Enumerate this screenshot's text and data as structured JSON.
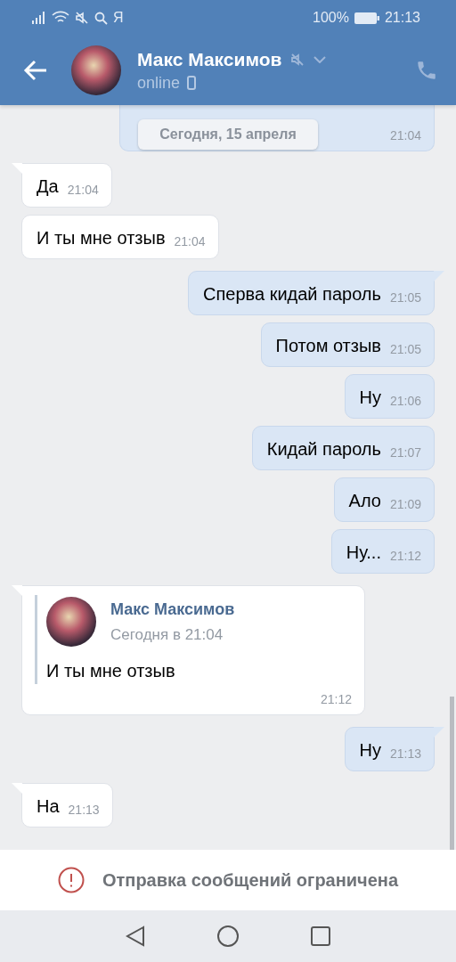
{
  "status_bar": {
    "carrier_glyph": "Я",
    "battery": "100%",
    "time": "21:13"
  },
  "header": {
    "name": "Макс Максимов",
    "status": "online",
    "muted": true
  },
  "date_pill": "Сегодня, 15 апреля",
  "messages": [
    {
      "kind": "cut",
      "time": "21:04"
    },
    {
      "kind": "in",
      "text": "Да",
      "time": "21:04",
      "tail": true
    },
    {
      "kind": "in",
      "text": "И ты мне отзыв",
      "time": "21:04",
      "tail": false
    },
    {
      "kind": "out",
      "text": "Сперва кидай пароль",
      "time": "21:05",
      "tail": true
    },
    {
      "kind": "out",
      "text": "Потом отзыв",
      "time": "21:05",
      "tail": false
    },
    {
      "kind": "out",
      "text": "Ну",
      "time": "21:06",
      "tail": false
    },
    {
      "kind": "out",
      "text": "Кидай пароль",
      "time": "21:07",
      "tail": false
    },
    {
      "kind": "out",
      "text": "Ало",
      "time": "21:09",
      "tail": false
    },
    {
      "kind": "out",
      "text": "Ну...",
      "time": "21:12",
      "tail": false
    },
    {
      "kind": "forward",
      "author": "Макс Максимов",
      "date": "Сегодня в 21:04",
      "text": "И ты мне отзыв",
      "time": "21:12",
      "tail": true
    },
    {
      "kind": "out",
      "text": "Ну",
      "time": "21:13",
      "tail": true
    },
    {
      "kind": "in",
      "text": "На",
      "time": "21:13",
      "tail": true
    }
  ],
  "notice": "Отправка сообщений ограничена"
}
